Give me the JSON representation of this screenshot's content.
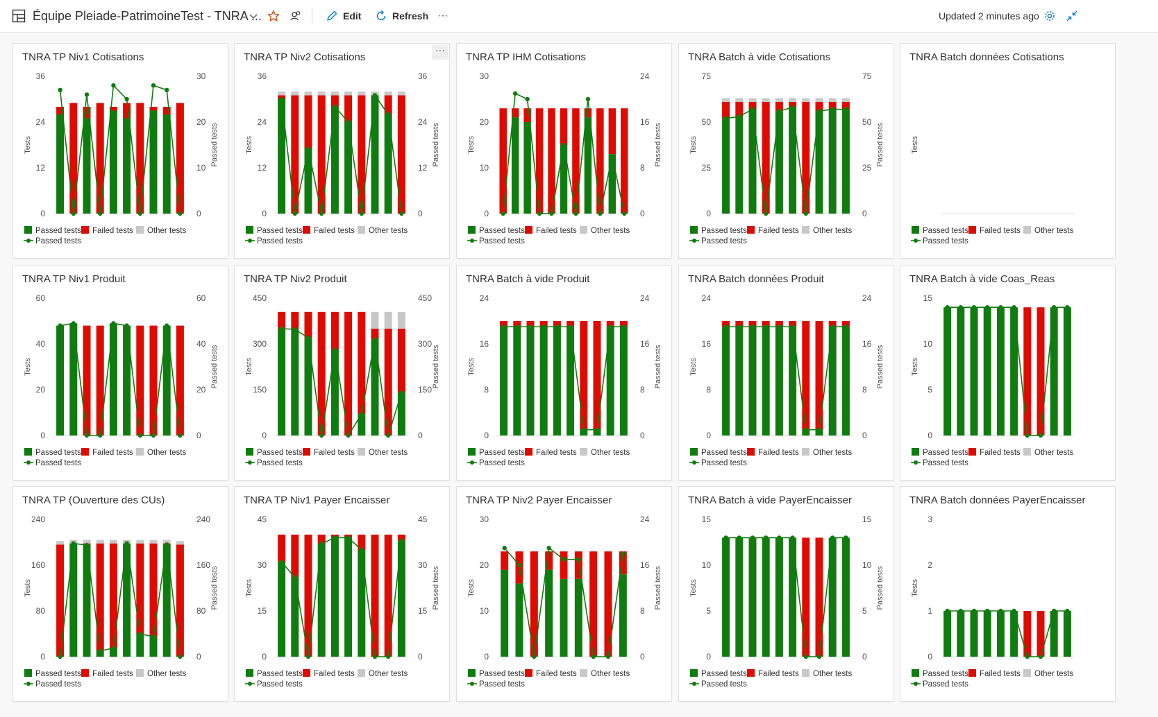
{
  "header": {
    "title": "Équipe Pleiade-PatrimoineTest - TNRA ...",
    "edit_label": "Edit",
    "refresh_label": "Refresh",
    "more_label": "···",
    "updated_label": "Updated 2 minutes ago"
  },
  "colors": {
    "passed": "#107c10",
    "failed": "#e00b00",
    "other": "#c8c8c8",
    "accent": "#0078d4",
    "star": "#ca5010"
  },
  "legend": {
    "passed_tests": "Passed tests",
    "failed_tests": "Failed tests",
    "other_tests": "Other tests",
    "passed_tests_line": "Passed tests"
  },
  "axis_labels": {
    "left": "Tests",
    "right": "Passed tests"
  },
  "chart_data": [
    {
      "title": "TNRA TP Niv1 Cotisations",
      "type": "bar",
      "ylim": [
        0,
        36
      ],
      "yticks": [
        0,
        12,
        24,
        36
      ],
      "y2lim": [
        0,
        30
      ],
      "y2ticks": [
        0,
        10,
        20,
        30
      ],
      "series": [
        {
          "name": "Passed tests",
          "values": [
            26,
            0,
            25,
            0,
            27,
            25,
            0,
            27,
            26,
            0
          ]
        },
        {
          "name": "Failed tests",
          "values": [
            2,
            29,
            3,
            29,
            1,
            4,
            29,
            1,
            2,
            29
          ]
        },
        {
          "name": "Other tests",
          "values": [
            0,
            0,
            0,
            0,
            0,
            0,
            0,
            0,
            0,
            0
          ]
        },
        {
          "name": "Passed tests",
          "values": [
            27,
            0,
            26,
            0,
            28,
            25,
            0,
            28,
            27,
            0
          ]
        }
      ]
    },
    {
      "title": "TNRA TP Niv2 Cotisations",
      "type": "bar",
      "ylim": [
        0,
        36
      ],
      "yticks": [
        0,
        12,
        24,
        36
      ],
      "y2lim": [
        0,
        36
      ],
      "y2ticks": [
        0,
        12,
        24,
        36
      ],
      "series": [
        {
          "name": "Passed tests",
          "values": [
            30,
            0,
            17,
            0,
            28,
            24,
            0,
            31,
            26,
            0
          ]
        },
        {
          "name": "Failed tests",
          "values": [
            1,
            31,
            14,
            31,
            3,
            7,
            31,
            0,
            5,
            31
          ]
        },
        {
          "name": "Other tests",
          "values": [
            1,
            1,
            1,
            1,
            1,
            1,
            1,
            1,
            1,
            1
          ]
        },
        {
          "name": "Passed tests",
          "values": [
            30,
            0,
            17,
            0,
            28,
            24,
            0,
            31,
            26,
            0
          ]
        }
      ]
    },
    {
      "title": "TNRA TP IHM Cotisations",
      "type": "bar",
      "ylim": [
        0,
        30
      ],
      "yticks": [
        0,
        10,
        20,
        30
      ],
      "y2lim": [
        0,
        24
      ],
      "y2ticks": [
        0,
        8,
        16,
        24
      ],
      "series": [
        {
          "name": "Passed tests",
          "values": [
            0,
            21,
            20,
            0,
            0,
            15,
            0,
            21,
            0,
            13,
            0
          ]
        },
        {
          "name": "Failed tests",
          "values": [
            23,
            2,
            3,
            23,
            23,
            8,
            23,
            2,
            23,
            10,
            23
          ]
        },
        {
          "name": "Other tests",
          "values": [
            0,
            0,
            0,
            0,
            0,
            0,
            0,
            0,
            0,
            0,
            0
          ]
        },
        {
          "name": "Passed tests",
          "values": [
            0,
            21,
            20,
            0,
            0,
            12,
            0,
            20,
            0,
            10,
            0
          ]
        }
      ]
    },
    {
      "title": "TNRA Batch à vide Cotisations",
      "type": "bar",
      "ylim": [
        0,
        75
      ],
      "yticks": [
        0,
        25,
        50,
        75
      ],
      "y2lim": [
        0,
        75
      ],
      "y2ticks": [
        0,
        25,
        50,
        75
      ],
      "series": [
        {
          "name": "Passed tests",
          "values": [
            52,
            53,
            57,
            0,
            56,
            58,
            0,
            56,
            57,
            57
          ]
        },
        {
          "name": "Failed tests",
          "values": [
            9,
            8,
            4,
            61,
            5,
            3,
            61,
            5,
            4,
            4
          ]
        },
        {
          "name": "Other tests",
          "values": [
            2,
            2,
            2,
            2,
            2,
            2,
            2,
            2,
            2,
            2
          ]
        },
        {
          "name": "Passed tests",
          "values": [
            52,
            53,
            57,
            0,
            56,
            58,
            0,
            56,
            57,
            57
          ]
        }
      ]
    },
    {
      "title": "TNRA Batch données Cotisations",
      "type": "bar",
      "ylim": [],
      "yticks": [],
      "y2lim": [],
      "y2ticks": [],
      "series": []
    },
    {
      "title": "TNRA TP Niv1 Produit",
      "type": "bar",
      "ylim": [
        0,
        60
      ],
      "yticks": [
        0,
        20,
        40,
        60
      ],
      "y2lim": [
        0,
        60
      ],
      "y2ticks": [
        0,
        20,
        40,
        60
      ],
      "series": [
        {
          "name": "Passed tests",
          "values": [
            48,
            49,
            0,
            0,
            49,
            48,
            0,
            0,
            48,
            0
          ]
        },
        {
          "name": "Failed tests",
          "values": [
            0,
            0,
            48,
            48,
            0,
            0,
            48,
            48,
            0,
            48
          ]
        },
        {
          "name": "Other tests",
          "values": [
            0,
            0,
            0,
            0,
            0,
            0,
            0,
            0,
            0,
            0
          ]
        },
        {
          "name": "Passed tests",
          "values": [
            48,
            49,
            0,
            0,
            49,
            48,
            0,
            0,
            48,
            0
          ]
        }
      ]
    },
    {
      "title": "TNRA TP Niv2 Produit",
      "type": "bar",
      "ylim": [
        0,
        450
      ],
      "yticks": [
        0,
        150,
        300,
        450
      ],
      "y2lim": [
        0,
        450
      ],
      "y2ticks": [
        0,
        150,
        300,
        450
      ],
      "series": [
        {
          "name": "Passed tests",
          "values": [
            350,
            348,
            320,
            0,
            280,
            0,
            70,
            315,
            0,
            140
          ]
        },
        {
          "name": "Failed tests",
          "values": [
            55,
            57,
            85,
            405,
            125,
            405,
            335,
            35,
            350,
            210
          ]
        },
        {
          "name": "Other tests",
          "values": [
            0,
            0,
            0,
            0,
            0,
            0,
            0,
            55,
            55,
            55
          ]
        },
        {
          "name": "Passed tests",
          "values": [
            350,
            348,
            320,
            0,
            280,
            0,
            70,
            315,
            0,
            140
          ]
        }
      ]
    },
    {
      "title": "TNRA Batch à vide Produit",
      "type": "bar",
      "ylim": [
        0,
        24
      ],
      "yticks": [
        0,
        8,
        16,
        24
      ],
      "y2lim": [
        0,
        24
      ],
      "y2ticks": [
        0,
        8,
        16,
        24
      ],
      "series": [
        {
          "name": "Passed tests",
          "values": [
            19,
            19,
            19,
            19,
            19,
            19,
            1,
            1,
            19,
            19
          ]
        },
        {
          "name": "Failed tests",
          "values": [
            1,
            1,
            1,
            1,
            1,
            1,
            19,
            19,
            1,
            1
          ]
        },
        {
          "name": "Other tests",
          "values": [
            0,
            0,
            0,
            0,
            0,
            0,
            0,
            0,
            0,
            0
          ]
        },
        {
          "name": "Passed tests",
          "values": [
            19,
            19,
            19,
            19,
            19,
            19,
            1,
            1,
            19,
            19
          ]
        }
      ]
    },
    {
      "title": "TNRA Batch données Produit",
      "type": "bar",
      "ylim": [
        0,
        24
      ],
      "yticks": [
        0,
        8,
        16,
        24
      ],
      "y2lim": [
        0,
        24
      ],
      "y2ticks": [
        0,
        8,
        16,
        24
      ],
      "series": [
        {
          "name": "Passed tests",
          "values": [
            19,
            19,
            19,
            19,
            19,
            19,
            1,
            1,
            19,
            19
          ]
        },
        {
          "name": "Failed tests",
          "values": [
            1,
            1,
            1,
            1,
            1,
            1,
            19,
            19,
            1,
            1
          ]
        },
        {
          "name": "Other tests",
          "values": [
            0,
            0,
            0,
            0,
            0,
            0,
            0,
            0,
            0,
            0
          ]
        },
        {
          "name": "Passed tests",
          "values": [
            19,
            19,
            19,
            19,
            19,
            19,
            1,
            1,
            19,
            19
          ]
        }
      ]
    },
    {
      "title": "TNRA Batch à vide Coas_Reas",
      "type": "bar",
      "ylim": [
        0,
        15
      ],
      "yticks": [
        0,
        5,
        10,
        15
      ],
      "y2lim": [],
      "y2ticks": [],
      "series": [
        {
          "name": "Passed tests",
          "values": [
            14,
            14,
            14,
            14,
            14,
            14,
            0,
            0,
            14,
            14
          ]
        },
        {
          "name": "Failed tests",
          "values": [
            0,
            0,
            0,
            0,
            0,
            0,
            14,
            14,
            0,
            0
          ]
        },
        {
          "name": "Other tests",
          "values": [
            0,
            0,
            0,
            0,
            0,
            0,
            0,
            0,
            0,
            0
          ]
        },
        {
          "name": "Passed tests",
          "values": [
            14,
            14,
            14,
            14,
            14,
            14,
            0,
            0,
            14,
            14
          ]
        }
      ]
    },
    {
      "title": "TNRA TP (Ouverture des CUs)",
      "type": "bar",
      "ylim": [
        0,
        240
      ],
      "yticks": [
        0,
        80,
        160,
        240
      ],
      "y2lim": [
        0,
        240
      ],
      "y2ticks": [
        0,
        80,
        160,
        240
      ],
      "series": [
        {
          "name": "Passed tests",
          "values": [
            0,
            198,
            195,
            10,
            15,
            198,
            40,
            35,
            196,
            0
          ]
        },
        {
          "name": "Failed tests",
          "values": [
            196,
            0,
            3,
            188,
            183,
            0,
            158,
            163,
            2,
            196
          ]
        },
        {
          "name": "Other tests",
          "values": [
            6,
            6,
            6,
            6,
            6,
            6,
            6,
            6,
            6,
            6
          ]
        },
        {
          "name": "Passed tests",
          "values": [
            0,
            198,
            195,
            10,
            15,
            198,
            40,
            35,
            196,
            0
          ]
        }
      ]
    },
    {
      "title": "TNRA TP Niv1 Payer Encaisser",
      "type": "bar",
      "ylim": [
        0,
        45
      ],
      "yticks": [
        0,
        15,
        30,
        45
      ],
      "y2lim": [
        0,
        45
      ],
      "y2ticks": [
        0,
        15,
        30,
        45
      ],
      "series": [
        {
          "name": "Passed tests",
          "values": [
            31,
            26,
            0,
            37,
            39,
            39,
            35,
            0,
            0,
            38
          ]
        },
        {
          "name": "Failed tests",
          "values": [
            9,
            14,
            40,
            3,
            1,
            1,
            5,
            40,
            40,
            2
          ]
        },
        {
          "name": "Other tests",
          "values": [
            0,
            0,
            0,
            0,
            0,
            0,
            0,
            0,
            0,
            0
          ]
        },
        {
          "name": "Passed tests",
          "values": [
            31,
            26,
            0,
            37,
            39,
            39,
            35,
            0,
            0,
            38
          ]
        }
      ]
    },
    {
      "title": "TNRA TP Niv2 Payer Encaisser",
      "type": "bar",
      "ylim": [
        0,
        30
      ],
      "yticks": [
        0,
        10,
        20,
        30
      ],
      "y2lim": [
        0,
        24
      ],
      "y2ticks": [
        0,
        8,
        16,
        24
      ],
      "series": [
        {
          "name": "Passed tests",
          "values": [
            19,
            16,
            0,
            19,
            17,
            17,
            0,
            0,
            18
          ]
        },
        {
          "name": "Failed tests",
          "values": [
            4,
            7,
            23,
            4,
            6,
            6,
            23,
            23,
            5
          ]
        },
        {
          "name": "Other tests",
          "values": [
            0,
            0,
            0,
            0,
            0,
            0,
            0,
            0,
            0
          ]
        },
        {
          "name": "Passed tests",
          "values": [
            19,
            16,
            0,
            19,
            17,
            17,
            0,
            0,
            18
          ]
        }
      ]
    },
    {
      "title": "TNRA Batch à vide PayerEncaisser",
      "type": "bar",
      "ylim": [
        0,
        15
      ],
      "yticks": [
        0,
        5,
        10,
        15
      ],
      "y2lim": [
        0,
        15
      ],
      "y2ticks": [
        0,
        5,
        10,
        15
      ],
      "series": [
        {
          "name": "Passed tests",
          "values": [
            13,
            13,
            13,
            13,
            13,
            13,
            0,
            0,
            13,
            13
          ]
        },
        {
          "name": "Failed tests",
          "values": [
            0,
            0,
            0,
            0,
            0,
            0,
            13,
            13,
            0,
            0
          ]
        },
        {
          "name": "Other tests",
          "values": [
            0,
            0,
            0,
            0,
            0,
            0,
            0,
            0,
            0,
            0
          ]
        },
        {
          "name": "Passed tests",
          "values": [
            13,
            13,
            13,
            13,
            13,
            13,
            0,
            0,
            13,
            13
          ]
        }
      ]
    },
    {
      "title": "TNRA Batch données PayerEncaisser",
      "type": "bar",
      "ylim": [
        0,
        3
      ],
      "yticks": [
        0,
        1,
        2,
        3
      ],
      "y2lim": [],
      "y2ticks": [],
      "series": [
        {
          "name": "Passed tests",
          "values": [
            1,
            1,
            1,
            1,
            1,
            1,
            0,
            0,
            1,
            1
          ]
        },
        {
          "name": "Failed tests",
          "values": [
            0,
            0,
            0,
            0,
            0,
            0,
            1,
            1,
            0,
            0
          ]
        },
        {
          "name": "Other tests",
          "values": [
            0,
            0,
            0,
            0,
            0,
            0,
            0,
            0,
            0,
            0
          ]
        },
        {
          "name": "Passed tests",
          "values": [
            1,
            1,
            1,
            1,
            1,
            1,
            0,
            0,
            1,
            1
          ]
        }
      ]
    }
  ]
}
